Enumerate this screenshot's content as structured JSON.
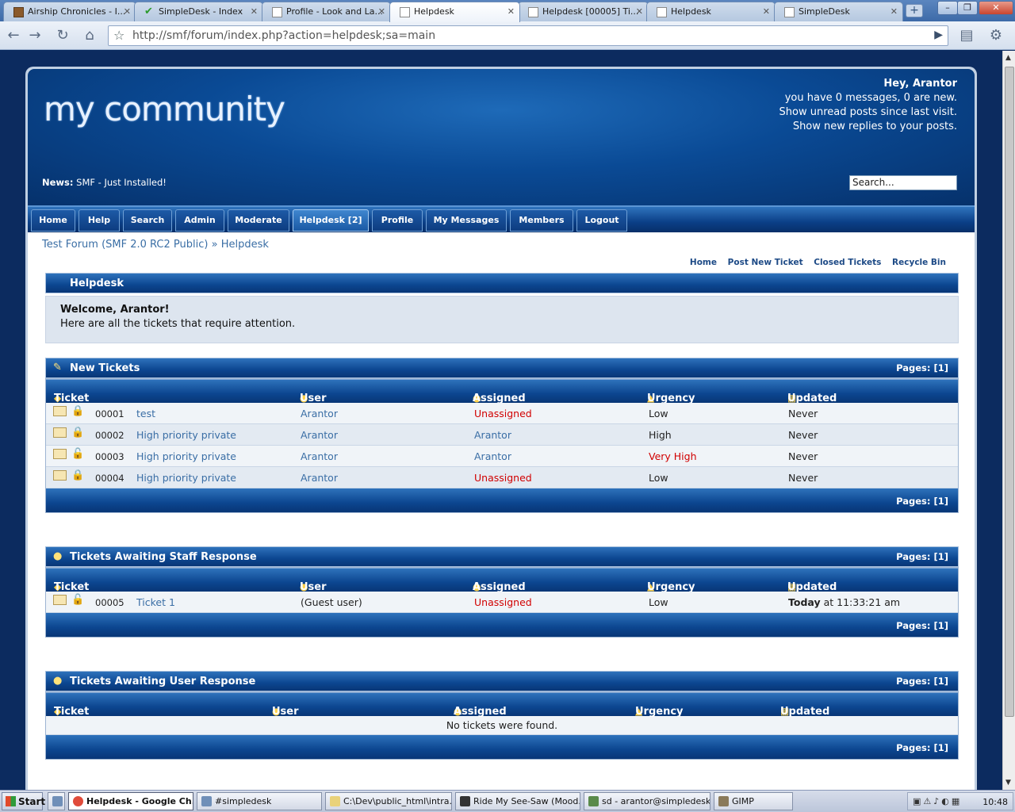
{
  "browser": {
    "tabs": [
      {
        "title": "Airship Chronicles - I...",
        "icon": "book-icon"
      },
      {
        "title": "SimpleDesk - Index",
        "icon": "checkmark-icon"
      },
      {
        "title": "Profile - Look and La...",
        "icon": "page-icon"
      },
      {
        "title": "Helpdesk",
        "icon": "page-icon",
        "active": true
      },
      {
        "title": "Helpdesk [00005] Ti...",
        "icon": "page-icon"
      },
      {
        "title": "Helpdesk",
        "icon": "page-icon"
      },
      {
        "title": "SimpleDesk",
        "icon": "page-icon"
      }
    ],
    "new_tab": "+",
    "url": "http://smf/forum/index.php?action=helpdesk;sa=main"
  },
  "site": {
    "logo": "my community",
    "user": {
      "greeting": "Hey, Arantor",
      "messages": "you have 0 messages, 0 are new.",
      "unread": "Show unread posts since last visit.",
      "replies": "Show new replies to your posts."
    },
    "news_label": "News:",
    "news_text": "SMF - Just Installed!",
    "search_placeholder": "Search..."
  },
  "menu": [
    "Home",
    "Help",
    "Search",
    "Admin",
    "Moderate",
    "Helpdesk [2]",
    "Profile",
    "My Messages",
    "Members",
    "Logout"
  ],
  "breadcrumb": {
    "root": "Test Forum (SMF 2.0 RC2 Public)",
    "sep": "»",
    "current": "Helpdesk"
  },
  "sublinks": [
    "Home",
    "Post New Ticket",
    "Closed Tickets",
    "Recycle Bin"
  ],
  "helpdesk": {
    "title": "Helpdesk",
    "welcome_title": "Welcome, Arantor!",
    "welcome_text": "Here are all the tickets that require attention."
  },
  "columns": [
    "Ticket",
    "User",
    "Assigned",
    "Urgency",
    "Updated"
  ],
  "pages_label": "Pages: [1]",
  "sections": {
    "new": {
      "title": "New Tickets",
      "rows": [
        {
          "id": "00001",
          "subject": "test",
          "user": "Arantor",
          "assigned": "Unassigned",
          "urgency": "Low",
          "updated": "Never"
        },
        {
          "id": "00002",
          "subject": "High priority private",
          "user": "Arantor",
          "assigned": "Arantor",
          "urgency": "High",
          "updated": "Never"
        },
        {
          "id": "00003",
          "subject": "High priority private",
          "user": "Arantor",
          "assigned": "Arantor",
          "urgency": "Very High",
          "updated": "Never"
        },
        {
          "id": "00004",
          "subject": "High priority private",
          "user": "Arantor",
          "assigned": "Unassigned",
          "urgency": "Low",
          "updated": "Never"
        }
      ]
    },
    "staff": {
      "title": "Tickets Awaiting Staff Response",
      "rows": [
        {
          "id": "00005",
          "subject": "Ticket 1",
          "user": "(Guest user)",
          "assigned": "Unassigned",
          "urgency": "Low",
          "updated_bold": "Today",
          "updated": "at 11:33:21 am"
        }
      ]
    },
    "user": {
      "title": "Tickets Awaiting User Response",
      "empty": "No tickets were found."
    }
  },
  "taskbar": {
    "start": "Start",
    "buttons": [
      "Helpdesk - Google Ch...",
      "#simpledesk",
      "C:\\Dev\\public_html\\intra...",
      "Ride My See-Saw (Mood...",
      "sd - arantor@simpledesk...",
      "GIMP"
    ],
    "clock": "10:48"
  },
  "colors": {
    "accent": "#0c4690",
    "link": "#3a6ea5",
    "alert": "#d10000"
  }
}
